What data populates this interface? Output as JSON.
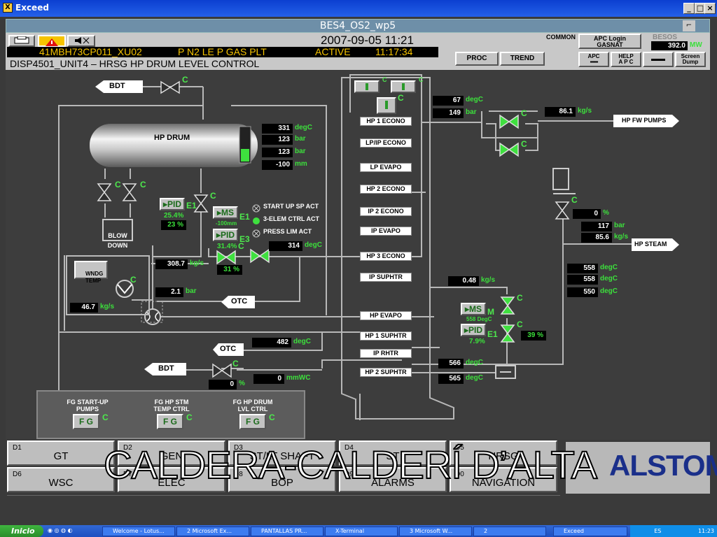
{
  "window": {
    "title": "Exceed",
    "minimize": "_",
    "maximize": "□",
    "close": "×",
    "app_title": "BES4_OS2_wp5",
    "scroll_glyph": "⌐"
  },
  "header": {
    "datetime": "2007-09-05  11:21",
    "tag": "41MBH73CP011_XU02",
    "description": "P N2 LE P GAS PLT",
    "status": "ACTIVE",
    "time": "11:17:34",
    "display": "DISP4501_UNIT4 – HRSG HP DRUM LEVEL CONTROL",
    "common": "COMMON",
    "apc_login": "APC Login",
    "gasnat": "GASNAT",
    "besos": "BESOS",
    "power_value": "392.0",
    "power_unit": "MW",
    "proc": "PROC",
    "trend": "TREND",
    "apc": "APC",
    "help_apc": "HELP\nA P C",
    "screen_dump": "Screen\nDump"
  },
  "mimic": {
    "bdt_top": "BDT",
    "bdt_bottom": "BDT",
    "otc_1": "OTC",
    "otc_2": "OTC",
    "hp_drum": "HP DRUM",
    "blow_down": "BLOW\nDOWN",
    "wndg_temp": "WNDG\nTEMP",
    "hp_fw_pumps": "HP FW PUMPS",
    "hp_steam": "HP STEAM",
    "c": "C",
    "drum_values": [
      {
        "v": "331",
        "u": "degC"
      },
      {
        "v": "123",
        "u": "bar"
      },
      {
        "v": "123",
        "u": "bar"
      },
      {
        "v": "-100",
        "u": "mm"
      }
    ],
    "pid1": {
      "label": "PID",
      "suffix": "E1",
      "pct1": "25.4%",
      "pct2": "23 %"
    },
    "ms1": {
      "label": "MS",
      "suffix": "E1",
      "sub": "-100mm"
    },
    "pid2": {
      "label": "PID",
      "suffix": "E3",
      "pct": "31.4%",
      "out": "31 %"
    },
    "status_items": [
      "START UP SP ACT",
      "3-ELEM CTRL ACT",
      "PRESS LIM ACT"
    ],
    "feed_temp": {
      "v": "314",
      "u": "degC"
    },
    "flow1": {
      "v": "308.7",
      "u": "kg/s"
    },
    "press1": {
      "v": "2.1",
      "u": "bar"
    },
    "flow2": {
      "v": "46.7",
      "u": "kg/s"
    },
    "econ_temp": {
      "v": "67",
      "u": "degC"
    },
    "econ_press": {
      "v": "149",
      "u": "bar"
    },
    "fw_flow": {
      "v": "86.1",
      "u": "kg/s"
    },
    "steam_valve_pct": {
      "v": "0",
      "u": "%"
    },
    "steam_press": {
      "v": "117",
      "u": "bar"
    },
    "steam_flow": {
      "v": "85.6",
      "u": "kg/s"
    },
    "steam_temps": [
      {
        "v": "558",
        "u": "degC"
      },
      {
        "v": "558",
        "u": "degC"
      },
      {
        "v": "550",
        "u": "degC"
      }
    ],
    "attemp_flow": {
      "v": "0.48",
      "u": "kg/s"
    },
    "ms2": {
      "label": "MS",
      "suffix": "M",
      "sub": "558 DegC"
    },
    "pid3": {
      "label": "PID",
      "suffix": "E1",
      "pct": "7.9%",
      "out": "39 %"
    },
    "sh_temp1": {
      "v": "566",
      "u": "degC"
    },
    "sh_temp2": {
      "v": "565",
      "u": "degC"
    },
    "otc_temp": {
      "v": "482",
      "u": "degC"
    },
    "bdt_pct": {
      "v": "0",
      "u": "%"
    },
    "bdt_press": {
      "v": "0",
      "u": "mmWC"
    },
    "hrsg_sections": [
      "HP 1 ECONO",
      "LP/IP ECONO",
      "LP EVAPO",
      "HP 2 ECONO",
      "IP 2 ECONO",
      "IP EVAPO",
      "HP 3 ECONO",
      "IP SUPHTR",
      "HP EVAPO",
      "HP 1 SUPHTR",
      "IP RHTR",
      "HP 2 SUPHTR"
    ]
  },
  "fg_panel": {
    "items": [
      {
        "label": "FG START-UP\nPUMPS",
        "btn": "F G"
      },
      {
        "label": "FG HP STM\nTEMP CTRL",
        "btn": "F G"
      },
      {
        "label": "FG HP DRUM\nLVL CTRL",
        "btn": "F G"
      }
    ]
  },
  "nav": {
    "row1": [
      {
        "n": "D1",
        "l": "GT"
      },
      {
        "n": "D2",
        "l": "GEN"
      },
      {
        "n": "D3",
        "l": "ST/LT SHAFT"
      },
      {
        "n": "D4",
        "l": "ST"
      },
      {
        "n": "D5",
        "l": "HRSG"
      }
    ],
    "row2": [
      {
        "n": "D6",
        "l": "WSC"
      },
      {
        "n": "D7",
        "l": "ELEC"
      },
      {
        "n": "D8",
        "l": "BOP"
      },
      {
        "n": "D9",
        "l": "ALARMS"
      },
      {
        "n": "D0",
        "l": "NAVIGATION"
      }
    ]
  },
  "overlay_caption": "CALDERA-CALDERÍ D’ALTA",
  "brand": "ALSTOM",
  "taskbar": {
    "start": "Inicio",
    "items": [
      "Welcome - Lotus...",
      "2 Microsoft Ex...",
      "PANTALLAS PR...",
      "X-Terminal",
      "3 Microsoft W...",
      "2",
      "Exceed"
    ],
    "lang": "ES",
    "clock": "11:23"
  },
  "colors": {
    "valve_green": "#3fe03f",
    "unit_green": "#3ce03c",
    "status_yellow": "#f6c400",
    "brand_blue": "#1a2f8a",
    "brand_red": "#d8202a"
  }
}
